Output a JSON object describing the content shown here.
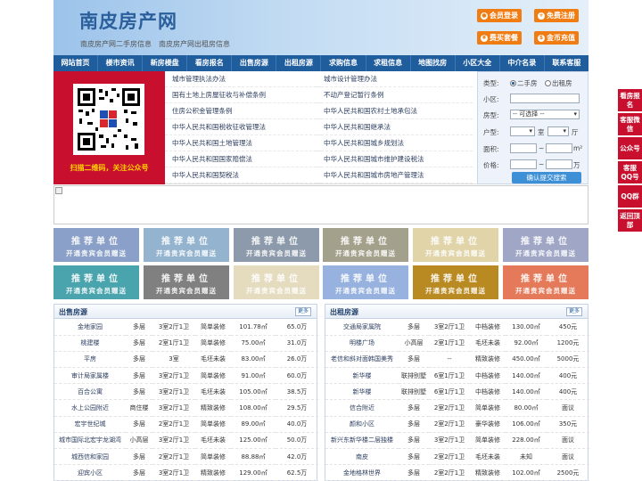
{
  "header": {
    "logo": "南皮房产网",
    "slogan": "南皮房产网二手房信息　南皮房产网出租房信息",
    "buttons": [
      {
        "label": "会员登录",
        "icon": "user-icon"
      },
      {
        "label": "免费注册",
        "icon": "register-icon"
      },
      {
        "label": "费买套餐",
        "icon": "cart-icon"
      },
      {
        "label": "金币充值",
        "icon": "coin-icon"
      }
    ]
  },
  "nav": [
    "网站首页",
    "楼市资讯",
    "新房楼盘",
    "看房报名",
    "出售房源",
    "出租房源",
    "求购信息",
    "求租信息",
    "地图找房",
    "小区大全",
    "中介名录",
    "联系客服"
  ],
  "qr": {
    "caption": "扫描二维码，关注公众号"
  },
  "links": {
    "left": [
      "城市管理执法办法",
      "国有土地上房屋征收与补偿条例",
      "住房公积金管理条例",
      "中华人民共和国税收征收管理法",
      "中华人民共和国土地管理法",
      "中华人民共和国国家赔偿法",
      "中华人民共和国契税法"
    ],
    "right": [
      "城市设计管理办法",
      "不动产登记暂行条例",
      "中华人民共和国农村土地承包法",
      "中华人民共和国继承法",
      "中华人民共和国城乡规划法",
      "中华人民共和国城市维护建设税法",
      "中华人民共和国城市房地产管理法"
    ]
  },
  "search": {
    "type_label": "类型:",
    "type_options": [
      "二手房",
      "出租房"
    ],
    "community_label": "小区:",
    "housetype_label": "房型:",
    "housetype_value": "-- 可选择 --",
    "layout_label": "户型:",
    "room_unit": "室",
    "hall_unit": "厅",
    "area_label": "面积:",
    "area_unit": "m²",
    "price_label": "价格:",
    "price_unit": "万",
    "range_sep": "~",
    "submit": "确认提交搜索"
  },
  "ads": {
    "title": "推荐单位",
    "sub": "开通贵宾会员赠送",
    "colors": [
      "#8aa0c8",
      "#93b3cf",
      "#8d9aab",
      "#a3a08c",
      "#e1d4a9",
      "#a0a7c6",
      "#4aa4ae",
      "#808080",
      "#e5dcc0",
      "#98b2e0",
      "#b98a22",
      "#e57a5a"
    ]
  },
  "sale": {
    "title": "出售房源",
    "more": "更多",
    "rows": [
      [
        "金地家园",
        "多层",
        "3室2厅1卫",
        "简单装修",
        "101.78㎡",
        "65.0万"
      ],
      [
        "桃建楼",
        "多层",
        "2室1厅1卫",
        "简单装修",
        "75.00㎡",
        "31.0万"
      ],
      [
        "平房",
        "多层",
        "3室",
        "毛坯未装",
        "83.00㎡",
        "26.0万"
      ],
      [
        "审计局家属楼",
        "多层",
        "3室2厅1卫",
        "简单装修",
        "91.00㎡",
        "60.0万"
      ],
      [
        "百合公寓",
        "多层",
        "3室2厅1卫",
        "毛坯未装",
        "105.00㎡",
        "38.5万"
      ],
      [
        "水上公园附近",
        "商住楼",
        "3室2厅1卫",
        "精致装修",
        "108.00㎡",
        "29.5万"
      ],
      [
        "宏宇世纪城",
        "多层",
        "2室2厅1卫",
        "简单装修",
        "89.00㎡",
        "40.0万"
      ],
      [
        "城市国际北宏宇龙湖湾",
        "小高层",
        "3室2厅1卫",
        "毛坯未装",
        "125.00㎡",
        "50.0万"
      ],
      [
        "城西信和家园",
        "多层",
        "2室2厅1卫",
        "简单装修",
        "88.88㎡",
        "42.0万"
      ],
      [
        "迎宾小区",
        "多层",
        "3室2厅1卫",
        "精致装修",
        "129.00㎡",
        "62.5万"
      ]
    ]
  },
  "rent": {
    "title": "出租房源",
    "more": "更多",
    "rows": [
      [
        "交通局家属院",
        "多层",
        "3室2厅1卫",
        "中档装修",
        "130.00㎡",
        "450元"
      ],
      [
        "明楼广场",
        "小高层",
        "2室1厅1卫",
        "毛坯未装",
        "92.00㎡",
        "1200元"
      ],
      [
        "老信和斜对面韩国美秀",
        "多层",
        "--",
        "精致装修",
        "450.00㎡",
        "5000元"
      ],
      [
        "新华楼",
        "联排别墅",
        "6室1厅1卫",
        "中档装修",
        "140.00㎡",
        "400元"
      ],
      [
        "新华楼",
        "联排别墅",
        "6室1厅1卫",
        "中档装修",
        "140.00㎡",
        "400元"
      ],
      [
        "信合附近",
        "多层",
        "2室2厅1卫",
        "简单装修",
        "80.00㎡",
        "面议"
      ],
      [
        "颜和小区",
        "多层",
        "2室2厅1卫",
        "豪华装修",
        "106.00㎡",
        "350元"
      ],
      [
        "新兴东新华楼二层独楼",
        "多层",
        "3室2厅1卫",
        "简单装修",
        "228.00㎡",
        "面议"
      ],
      [
        "南皮",
        "多层",
        "2室2厅1卫",
        "毛坯未装",
        "未知",
        "面议"
      ],
      [
        "金地格林世界",
        "多层",
        "2室2厅1卫",
        "精致装修",
        "102.00㎡",
        "2500元"
      ]
    ]
  },
  "sidebar": [
    "看房报名",
    "客服微信",
    "公众号",
    "客服QQ号",
    "QQ群",
    "返回顶部"
  ]
}
